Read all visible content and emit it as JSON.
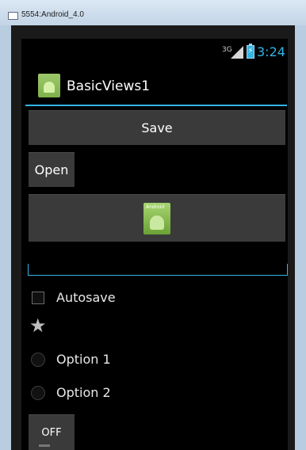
{
  "window": {
    "title": "5554:Android_4.0"
  },
  "status_bar": {
    "network": "3G",
    "time": "3:24"
  },
  "action_bar": {
    "title": "BasicViews1"
  },
  "buttons": {
    "save_label": "Save",
    "open_label": "Open"
  },
  "image_button": {
    "icon": "android-app-icon",
    "icon_text": "Android"
  },
  "checkbox": {
    "label": "Autosave",
    "checked": false
  },
  "star": {
    "icon": "star-icon",
    "checked": false
  },
  "radio_group": {
    "options": [
      {
        "label": "Option 1",
        "selected": false
      },
      {
        "label": "Option 2",
        "selected": false
      }
    ]
  },
  "toggle": {
    "label": "OFF",
    "state": "off"
  },
  "colors": {
    "accent": "#33b5e5",
    "button": "#3a3a3a",
    "screen": "#000000"
  }
}
